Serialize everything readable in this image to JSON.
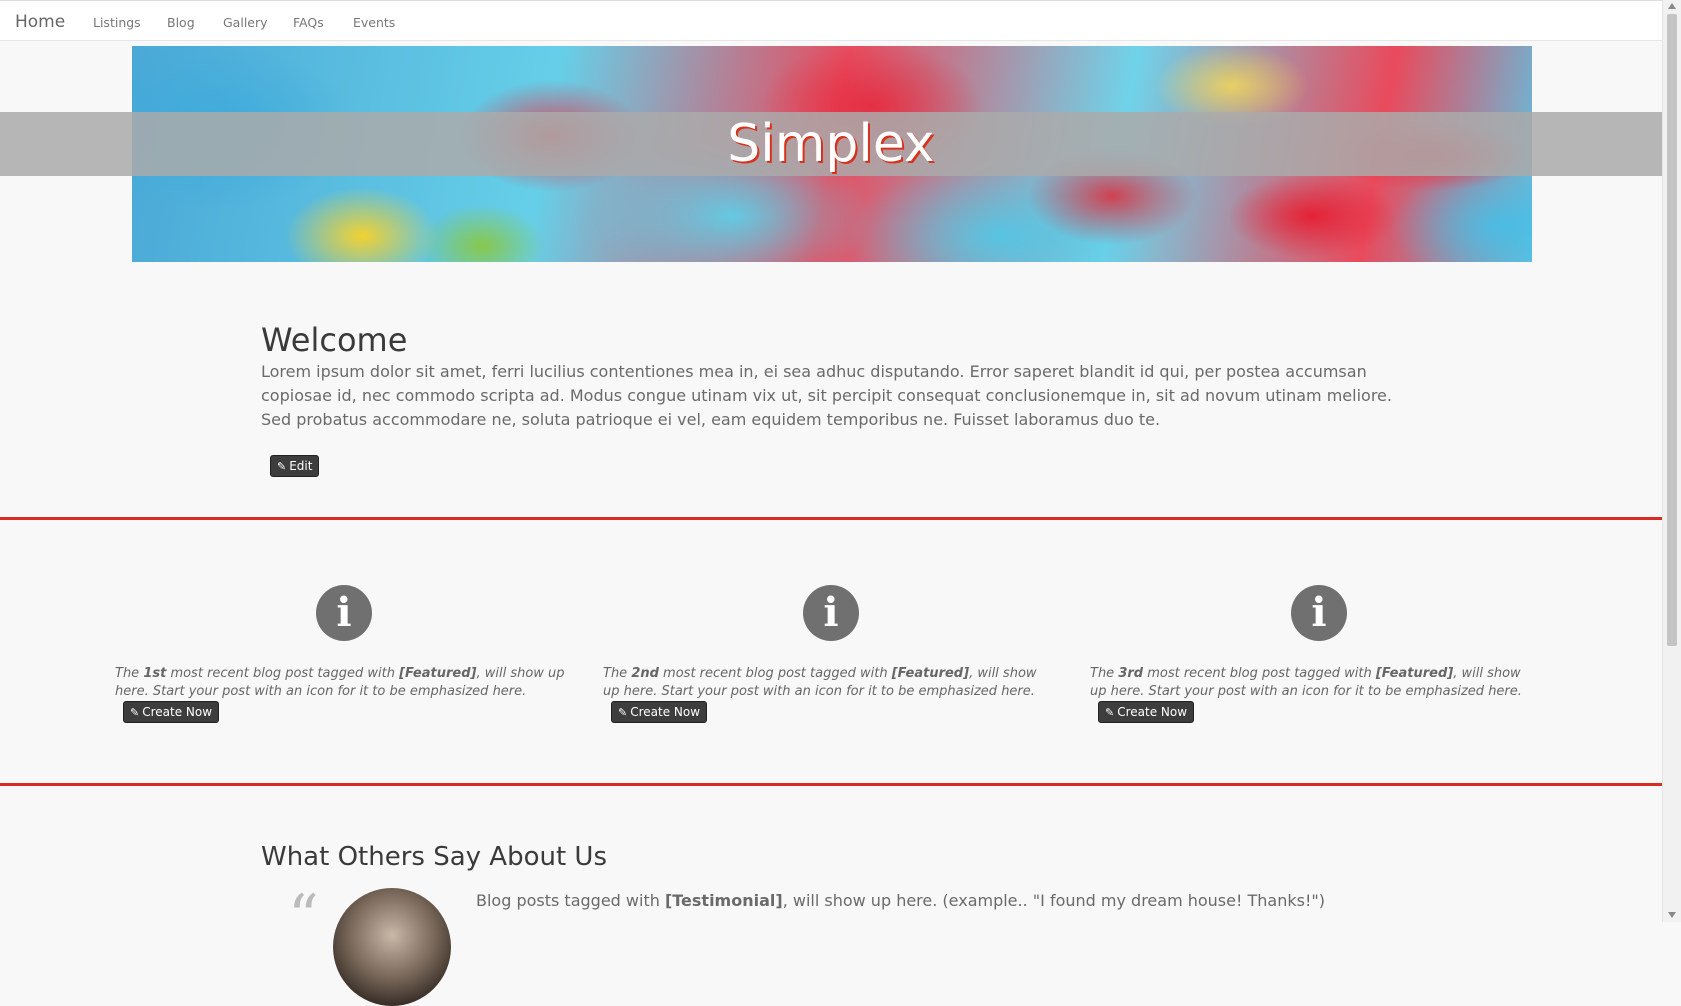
{
  "nav": {
    "brand": "Home",
    "links": [
      "Listings",
      "Blog",
      "Gallery",
      "FAQs",
      "Events"
    ]
  },
  "hero": {
    "title": "Simplex"
  },
  "welcome": {
    "title": "Welcome",
    "text": "Lorem ipsum dolor sit amet, ferri lucilius contentiones mea in, ei sea adhuc disputando. Error saperet blandit id qui, per postea accumsan copiosae id, nec commodo scripta ad. Modus congue utinam vix ut, sit percipit consequat conclusionemque in, sit ad novum utinam meliore. Sed probatus accommodare ne, soluta patrioque ei vel, eam equidem temporibus ne. Fuisset laboramus duo te.",
    "edit_label": "Edit"
  },
  "features": [
    {
      "prefix": "The ",
      "ordinal": "1st",
      "middle": " most recent blog post tagged with ",
      "tag": "[Featured]",
      "suffix": ", will show up here. Start your post with an icon for it to be emphasized here.",
      "button": "Create Now"
    },
    {
      "prefix": "The ",
      "ordinal": "2nd",
      "middle": " most recent blog post tagged with ",
      "tag": "[Featured]",
      "suffix": ", will show up here. Start your post with an icon for it to be emphasized here.",
      "button": "Create Now"
    },
    {
      "prefix": "The ",
      "ordinal": "3rd",
      "middle": " most recent blog post tagged with ",
      "tag": "[Featured]",
      "suffix": ", will show up here. Start your post with an icon for it to be emphasized here.",
      "button": "Create Now"
    }
  ],
  "testimonials": {
    "title": "What Others Say About Us",
    "text_prefix": "Blog posts tagged with ",
    "text_tag": "[Testimonial]",
    "text_suffix": ", will show up here. (example.. \"I found my dream house! Thanks!\")",
    "quote_glyph": "“"
  },
  "icons": {
    "feature_icon": "info-circle-icon",
    "edit_icon": "pencil-icon"
  },
  "colors": {
    "accent": "#d82b21",
    "button_bg": "#3d3d3d",
    "icon_bg": "#707070"
  }
}
